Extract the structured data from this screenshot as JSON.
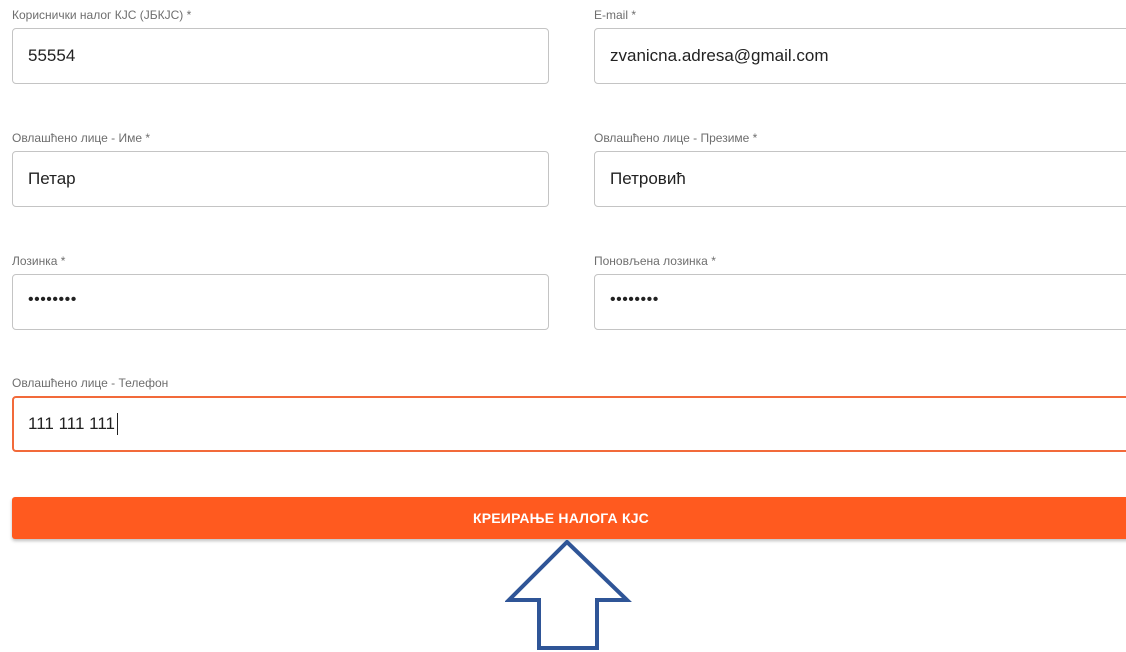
{
  "form": {
    "account": {
      "label": "Кориснички налог КЈС (ЈБКЈС) *",
      "value": "55554"
    },
    "email": {
      "label": "E-mail *",
      "value": "zvanicna.adresa@gmail.com"
    },
    "first_name": {
      "label": "Овлашћено лице - Име *",
      "value": "Петар"
    },
    "last_name": {
      "label": "Овлашћено лице - Презиме *",
      "value": "Петровић"
    },
    "password": {
      "label": "Лозинка *",
      "value": "••••••••"
    },
    "password_repeat": {
      "label": "Поновљена лозинка *",
      "value": "••••••••"
    },
    "phone": {
      "label": "Овлашћено лице - Телефон",
      "value": "111 111 111"
    },
    "submit_label": "КРЕИРАЊЕ НАЛОГА КЈС"
  },
  "colors": {
    "accent": "#ff5a1f",
    "focus_border": "#f26a3a",
    "arrow_stroke": "#2f5597"
  },
  "annotation": {
    "icon": "up-arrow-icon"
  }
}
